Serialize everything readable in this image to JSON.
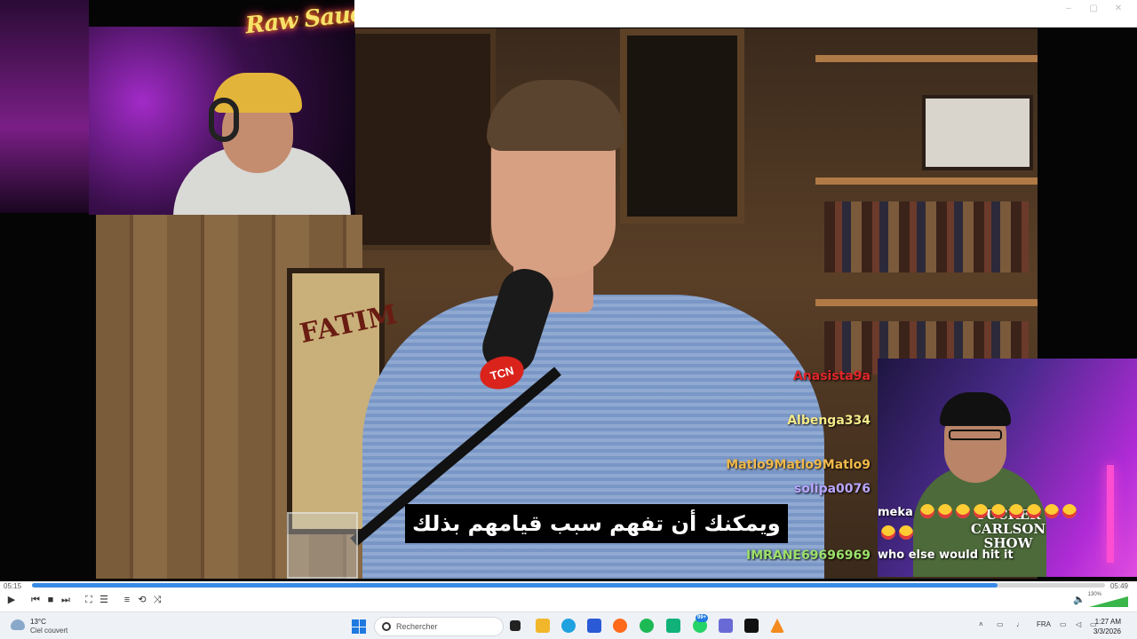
{
  "overlay": {
    "channel_logo": "Raw Saueet"
  },
  "video": {
    "poster_text": "FATIM",
    "mic_badge": "TCN",
    "subtitle": "ويمكنك أن تفهم سبب قيامهم بذلك",
    "show_logo": "TUCKER CARLSON SHOW"
  },
  "chat": {
    "lines": [
      {
        "user": "Anasista9a",
        "color": "#e0262b"
      },
      {
        "user": "Albenga334",
        "color": "#f4e98a"
      },
      {
        "user": "Matlo9Matlo9Matlo9",
        "color": "#f0b84a"
      },
      {
        "user": "solipa0076",
        "color": "#b9a6ff"
      },
      {
        "user": "IMRANE69696969",
        "color": "#9be06a"
      }
    ],
    "messages": [
      {
        "text": "meka",
        "emoji_count": 9
      },
      {
        "text": "",
        "emoji_count": 2
      },
      {
        "text": "who else would hit it",
        "emoji_count": 0
      }
    ]
  },
  "player": {
    "elapsed": "05:15",
    "total": "05:49",
    "progress": 0.9,
    "volume_label": "130%",
    "volume": 1.0,
    "controls": [
      "play-icon",
      "previous-icon",
      "stop-icon",
      "next-icon",
      "fullscreen-icon",
      "equalizer-icon",
      "playlist-icon",
      "loop-icon",
      "shuffle-icon"
    ]
  },
  "taskbar": {
    "weather_temp": "13°C",
    "weather_desc": "Ciel couvert",
    "search_placeholder": "Rechercher",
    "notification_badge": "99+",
    "language": "FRA",
    "time": "1:27 AM",
    "date": "3/3/2026",
    "apps": [
      "task-view-icon",
      "file-explorer-icon",
      "edge-icon",
      "store-icon",
      "firefox-icon",
      "spotify-icon",
      "app-icon",
      "whatsapp-icon",
      "snipping-icon",
      "capcut-icon",
      "vlc-icon"
    ]
  },
  "colors": {
    "accent": "#3a8be6",
    "volume": "#39b54a"
  }
}
